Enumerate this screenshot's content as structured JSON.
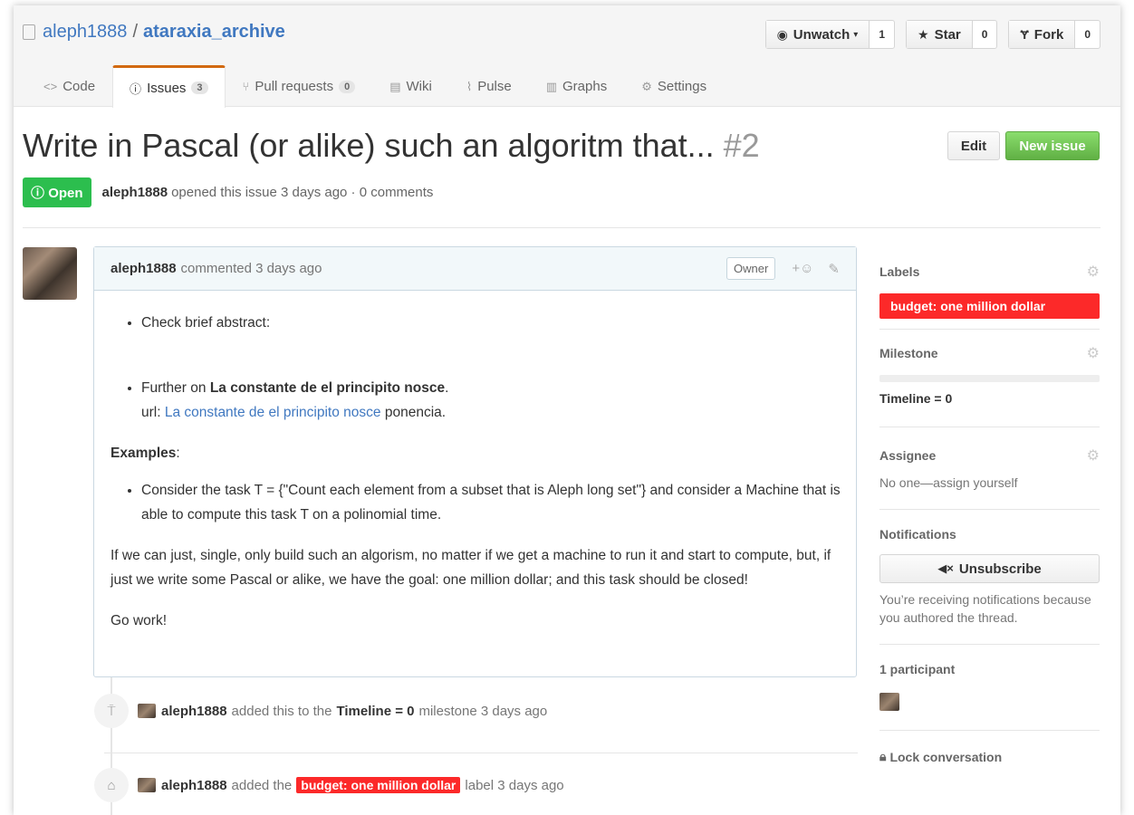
{
  "repo": {
    "owner": "aleph1888",
    "separator": "/",
    "name": "ataraxia_archive"
  },
  "actions": {
    "unwatch": {
      "label": "Unwatch",
      "count": "1"
    },
    "star": {
      "label": "Star",
      "count": "0"
    },
    "fork": {
      "label": "Fork",
      "count": "0"
    }
  },
  "tabs": [
    {
      "label": "Code",
      "icon": "code-icon"
    },
    {
      "label": "Issues",
      "icon": "issue-opened-icon",
      "count": "3"
    },
    {
      "label": "Pull requests",
      "icon": "pull-request-icon",
      "count": "0"
    },
    {
      "label": "Wiki",
      "icon": "book-icon"
    },
    {
      "label": "Pulse",
      "icon": "pulse-icon"
    },
    {
      "label": "Graphs",
      "icon": "graph-icon"
    },
    {
      "label": "Settings",
      "icon": "gear-icon"
    }
  ],
  "issue": {
    "title": "Write in Pascal (or alike) such an algoritm that...",
    "number": "#2",
    "edit_label": "Edit",
    "new_issue_label": "New issue",
    "state": "Open",
    "author": "aleph1888",
    "meta_text": "opened this issue 3 days ago · 0 comments"
  },
  "comment": {
    "author": "aleph1888",
    "when": "commented 3 days ago",
    "owner_badge": "Owner",
    "react": "+☺",
    "bullet1": "Check brief abstract:",
    "bullet2_prefix": "Further on ",
    "bullet2_bold": "La constante de el principito nosce",
    "bullet2_suffix": ".",
    "url_prefix": "url: ",
    "url_link": "La constante de el principito nosce",
    "url_suffix": " ponencia.",
    "examples_bold": "Examples",
    "examples_colon": ":",
    "bullet3": "Consider the task T = {\"Count each element from a subset that is Aleph long set\"} and consider a Machine that is able to compute this task T on a polinomial time.",
    "para1": "If we can just, single, only build such an algorism, no matter if we get a machine to run it and start to compute, but, if just we write some Pascal or alike, we have the goal: one million dollar; and this task should be closed!",
    "para2": "Go work!"
  },
  "events": [
    {
      "author": "aleph1888",
      "pre": "added this to the",
      "bold": "Timeline = 0",
      "post": "milestone 3 days ago"
    },
    {
      "author": "aleph1888",
      "pre": "added the",
      "label": "budget: one million dollar",
      "post": "label 3 days ago"
    }
  ],
  "sidebar": {
    "labels_title": "Labels",
    "label_name": "budget: one million dollar",
    "milestone_title": "Milestone",
    "milestone_name": "Timeline = 0",
    "assignee_title": "Assignee",
    "assignee_text": "No one—assign yourself",
    "notifications_title": "Notifications",
    "unsubscribe_label": "Unsubscribe",
    "notif_text": "You’re receiving notifications because you authored the thread.",
    "participants": "1 participant",
    "lock_label": "Lock conversation"
  },
  "colors": {
    "link": "#4078c0",
    "open_green": "#2cbe4e",
    "label_red": "#fc2929",
    "tab_accent": "#d26911"
  }
}
